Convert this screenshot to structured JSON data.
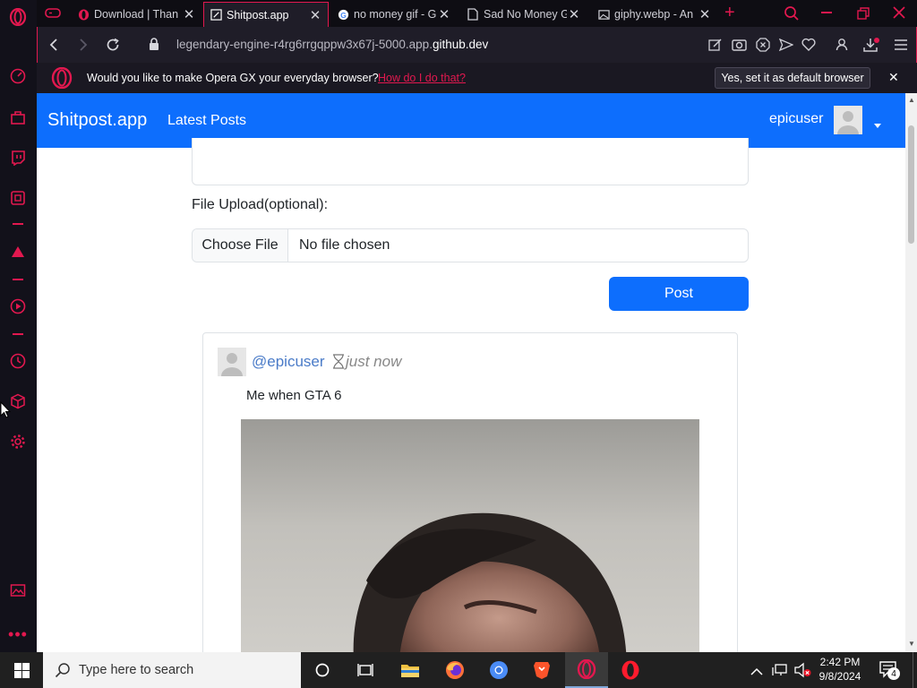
{
  "browser": {
    "tabs": [
      {
        "label": "Download | Than",
        "icon": "opera-icon"
      },
      {
        "label": "Shitpost.app",
        "icon": "page-icon",
        "active": true
      },
      {
        "label": "no money gif - G",
        "icon": "google-icon"
      },
      {
        "label": "Sad No Money G",
        "icon": "doc-icon"
      },
      {
        "label": "giphy.webp - An",
        "icon": "image-icon"
      }
    ],
    "url_prefix": "legendary-engine-r4rg6rrgqppw3x67j-5000.app.",
    "url_domain": "github.dev",
    "banner": {
      "text": "Would you like to make Opera GX your everyday browser?",
      "link": "How do I do that?",
      "button": "Yes, set it as default browser"
    }
  },
  "site": {
    "brand": "Shitpost.app",
    "nav_link": "Latest Posts",
    "username": "epicuser",
    "form": {
      "file_label": "File Upload(optional):",
      "choose_button": "Choose File",
      "no_file": "No file chosen",
      "post_button": "Post"
    },
    "post": {
      "author": "@epicuser",
      "time": "just now",
      "body": "Me when GTA 6"
    }
  },
  "taskbar": {
    "search_placeholder": "Type here to search",
    "time": "2:42 PM",
    "date": "9/8/2024",
    "notifications": "4"
  },
  "colors": {
    "opera_red": "#e2184f",
    "primary": "#0d6efd"
  }
}
